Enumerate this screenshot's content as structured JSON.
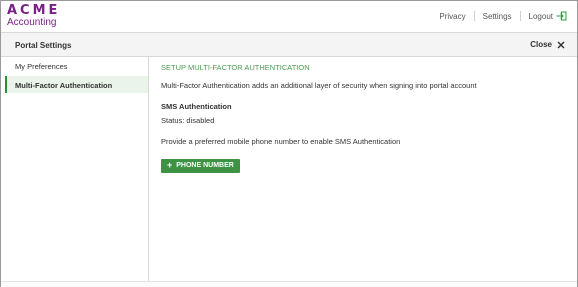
{
  "brand": {
    "line1": "ACME",
    "line2": "Accounting"
  },
  "topnav": {
    "privacy": "Privacy",
    "settings": "Settings",
    "logout": "Logout",
    "logout_icon": "logout-icon"
  },
  "panel": {
    "title": "Portal Settings",
    "close": "Close",
    "close_icon": "close-icon"
  },
  "sidebar": {
    "items": [
      {
        "label": "My Preferences",
        "active": false
      },
      {
        "label": "Multi-Factor Authentication",
        "active": true
      }
    ]
  },
  "main": {
    "section_title": "SETUP MULTI-FACTOR AUTHENTICATION",
    "description": "Multi-Factor Authentication adds an additional layer of security when signing into portal account",
    "sms_title": "SMS Authentication",
    "status": "Status: disabled",
    "instruction": "Provide a preferred mobile phone number to enable SMS Authentication",
    "button_label": "PHONE NUMBER",
    "button_icon": "plus-icon"
  },
  "colors": {
    "brand": "#7a1f86",
    "accent_green": "#3f9143",
    "section_green": "#4a9c4f"
  }
}
